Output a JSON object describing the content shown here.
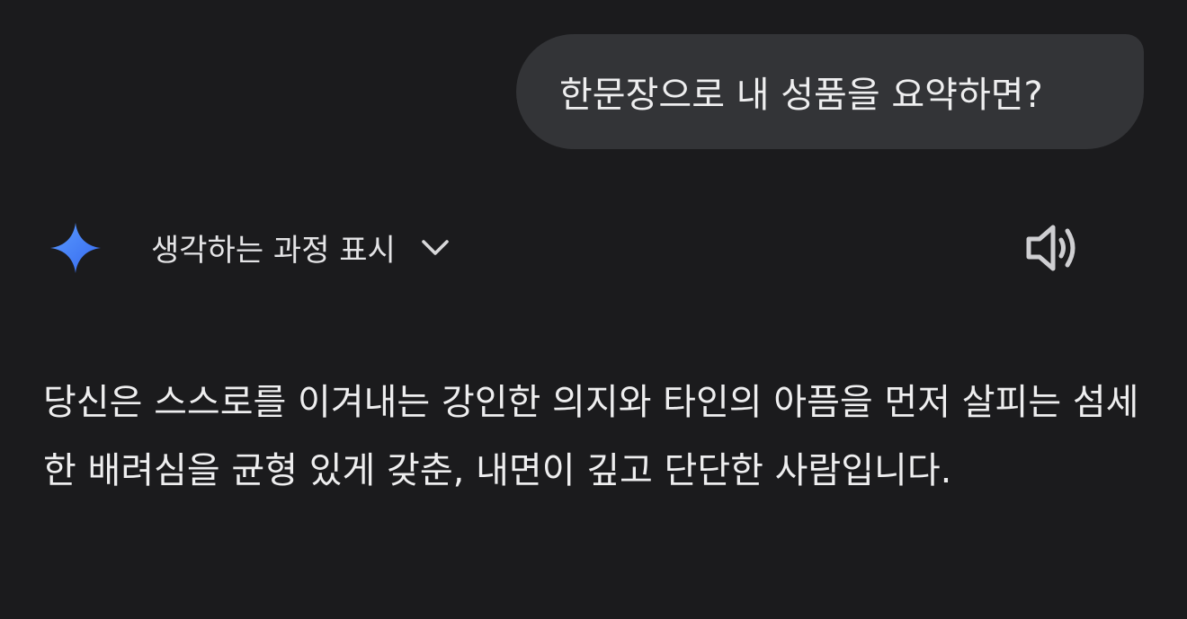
{
  "user_message": {
    "text": "한문장으로 내 성품을 요약하면?"
  },
  "response": {
    "assistant_icon": "sparkle-icon",
    "thinking_toggle_label": "생각하는 과정 표시",
    "thinking_toggle_icon": "chevron-down-icon",
    "read_aloud_icon": "speaker-icon",
    "text": "당신은 스스로를 이겨내는 강인한 의지와 타인의 아픔을 먼저 살피는 섬세한 배려심을 균형 있게 갖춘, 내면이 깊고 단단한 사람입니다."
  },
  "colors": {
    "background": "#1b1b1d",
    "bubble": "#333437",
    "text": "#eeeeef",
    "sparkle_start": "#4c8dff",
    "sparkle_end": "#3a6cf0"
  }
}
